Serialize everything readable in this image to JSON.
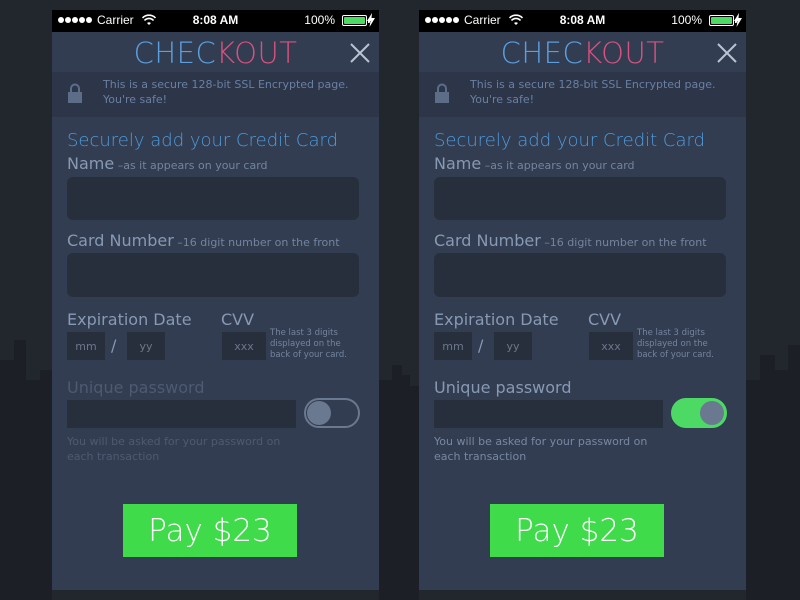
{
  "colors": {
    "background": "#22262d",
    "panel": "#323d51",
    "accent_blue": "#5b9fe0",
    "accent_pink": "#d8527f",
    "pay_green": "#3fdb4a",
    "toggle_on": "#4cd964"
  },
  "screens": [
    {
      "status": {
        "carrier": "Carrier",
        "time": "8:08 AM",
        "battery": "100%"
      },
      "title": {
        "part1": "CHEC",
        "part2": "KOUT"
      },
      "secure_text": "This is a secure 128-bit SSL Encrypted page. You're safe!",
      "heading": "Securely add your Credit Card",
      "name_label": "Name",
      "name_hint": " –as it appears on your card",
      "card_label": "Card Number",
      "card_hint": " –16 digit number on the front",
      "exp_label": "Expiration Date",
      "exp_mm_placeholder": "mm",
      "exp_slash": "/",
      "exp_yy_placeholder": "yy",
      "cvv_label": "CVV",
      "cvv_placeholder": "xxx",
      "cvv_hint": "The last 3 digits displayed on the back of your card.",
      "password_label": "Unique password",
      "password_toggle_on": false,
      "password_note": "You will be asked for your password on each transaction",
      "pay_label": "Pay $23"
    },
    {
      "status": {
        "carrier": "Carrier",
        "time": "8:08 AM",
        "battery": "100%"
      },
      "title": {
        "part1": "CHEC",
        "part2": "KOUT"
      },
      "secure_text": "This is a secure 128-bit SSL Encrypted page. You're safe!",
      "heading": "Securely add your Credit Card",
      "name_label": "Name",
      "name_hint": " –as it appears on your card",
      "card_label": "Card Number",
      "card_hint": " –16 digit number on the front",
      "exp_label": "Expiration Date",
      "exp_mm_placeholder": "mm",
      "exp_slash": "/",
      "exp_yy_placeholder": "yy",
      "cvv_label": "CVV",
      "cvv_placeholder": "xxx",
      "cvv_hint": "The last 3 digits displayed on the back of your card.",
      "password_label": "Unique password",
      "password_toggle_on": true,
      "password_note": "You will be asked for your password on each transaction",
      "pay_label": "Pay $23"
    }
  ]
}
